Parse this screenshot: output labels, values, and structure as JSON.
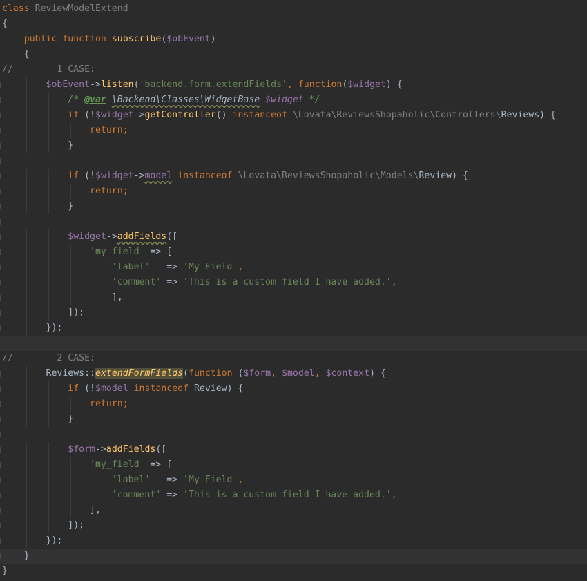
{
  "editor": {
    "lines": [
      [
        [
          "class",
          "kw"
        ],
        [
          " ReviewModelExtend",
          "cmt"
        ]
      ],
      [
        [
          "{",
          "p"
        ]
      ],
      [
        [
          "    ",
          "p"
        ],
        [
          "public",
          "kw"
        ],
        [
          " ",
          "p"
        ],
        [
          "function",
          "kw"
        ],
        [
          " ",
          "p"
        ],
        [
          "subscribe",
          "fn"
        ],
        [
          "(",
          "p"
        ],
        [
          "$obEvent",
          "var"
        ],
        [
          ")",
          "p"
        ]
      ],
      [
        [
          "    {",
          "p"
        ]
      ],
      [
        [
          "//        1 CASE:",
          "cmt"
        ]
      ],
      [
        [
          "        ",
          "p"
        ],
        [
          "$obEvent",
          "var"
        ],
        [
          "->",
          "p"
        ],
        [
          "listen",
          "fn"
        ],
        [
          "(",
          "p"
        ],
        [
          "'backend.form.extendFields'",
          "str"
        ],
        [
          ", ",
          "kw"
        ],
        [
          "function",
          "kw"
        ],
        [
          "(",
          "p"
        ],
        [
          "$widget",
          "var"
        ],
        [
          ") {",
          "p"
        ]
      ],
      [
        [
          "            ",
          "p"
        ],
        [
          "/* ",
          "doc"
        ],
        [
          "@var",
          "doctag"
        ],
        [
          " ",
          "doc"
        ],
        [
          "\\Backend\\Classes\\WidgetBase",
          "ital warn"
        ],
        [
          " ",
          "doc"
        ],
        [
          "$widget",
          "docvar"
        ],
        [
          " */",
          "doc"
        ]
      ],
      [
        [
          "            ",
          "p"
        ],
        [
          "if",
          "kw"
        ],
        [
          " (!",
          "p"
        ],
        [
          "$widget",
          "var"
        ],
        [
          "->",
          "p"
        ],
        [
          "getController",
          "fn"
        ],
        [
          "() ",
          "p"
        ],
        [
          "instanceof",
          "kw"
        ],
        [
          " \\Lovata\\ReviewsShopaholic\\Controllers\\",
          "ns"
        ],
        [
          "Reviews",
          "p"
        ],
        [
          ") {",
          "p"
        ]
      ],
      [
        [
          "                ",
          "p"
        ],
        [
          "return",
          "kw"
        ],
        [
          ";",
          "kw"
        ]
      ],
      [
        [
          "            }",
          "p"
        ]
      ],
      [
        [
          "",
          "p"
        ]
      ],
      [
        [
          "            ",
          "p"
        ],
        [
          "if",
          "kw"
        ],
        [
          " (!",
          "p"
        ],
        [
          "$widget",
          "var"
        ],
        [
          "->",
          "p"
        ],
        [
          "model",
          "var warn"
        ],
        [
          " ",
          "p"
        ],
        [
          "instanceof",
          "kw"
        ],
        [
          " \\Lovata\\ReviewsShopaholic\\Models\\",
          "ns"
        ],
        [
          "Review",
          "p"
        ],
        [
          ") {",
          "p"
        ]
      ],
      [
        [
          "                ",
          "p"
        ],
        [
          "return",
          "kw"
        ],
        [
          ";",
          "kw"
        ]
      ],
      [
        [
          "            }",
          "p"
        ]
      ],
      [
        [
          "",
          "p"
        ]
      ],
      [
        [
          "            ",
          "p"
        ],
        [
          "$widget",
          "var"
        ],
        [
          "->",
          "p"
        ],
        [
          "addFields",
          "fn warn"
        ],
        [
          "([",
          "p"
        ]
      ],
      [
        [
          "                ",
          "p"
        ],
        [
          "'my_field'",
          "str"
        ],
        [
          " => [",
          "p"
        ]
      ],
      [
        [
          "                    ",
          "p"
        ],
        [
          "'label'",
          "str"
        ],
        [
          "   => ",
          "p"
        ],
        [
          "'My Field'",
          "str"
        ],
        [
          ",",
          "kw"
        ]
      ],
      [
        [
          "                    ",
          "p"
        ],
        [
          "'comment'",
          "str"
        ],
        [
          " => ",
          "p"
        ],
        [
          "'This is a custom field I have added.'",
          "str"
        ],
        [
          ",",
          "kw"
        ]
      ],
      [
        [
          "                    ",
          "p"
        ],
        [
          "],",
          "p"
        ]
      ],
      [
        [
          "            ",
          "p"
        ],
        [
          "]);",
          "p"
        ]
      ],
      [
        [
          "        ",
          "p"
        ],
        [
          "});",
          "p"
        ]
      ],
      [
        [
          "",
          "p"
        ]
      ],
      [
        [
          "//        2 CASE:",
          "cmt"
        ]
      ],
      [
        [
          "        ",
          "p"
        ],
        [
          "Reviews::",
          "p"
        ],
        [
          "extendFormFields",
          "fn ital hl"
        ],
        [
          "(",
          "p"
        ],
        [
          "function",
          "kw"
        ],
        [
          " (",
          "p"
        ],
        [
          "$form",
          "var"
        ],
        [
          ", ",
          "kw"
        ],
        [
          "$model",
          "var"
        ],
        [
          ", ",
          "kw"
        ],
        [
          "$context",
          "var"
        ],
        [
          ") {",
          "p"
        ]
      ],
      [
        [
          "            ",
          "p"
        ],
        [
          "if",
          "kw"
        ],
        [
          " (!",
          "p"
        ],
        [
          "$model",
          "var"
        ],
        [
          " ",
          "p"
        ],
        [
          "instanceof",
          "kw"
        ],
        [
          " Review) {",
          "p"
        ]
      ],
      [
        [
          "                ",
          "p"
        ],
        [
          "return",
          "kw"
        ],
        [
          ";",
          "kw"
        ]
      ],
      [
        [
          "            }",
          "p"
        ]
      ],
      [
        [
          "",
          "p"
        ]
      ],
      [
        [
          "            ",
          "p"
        ],
        [
          "$form",
          "var"
        ],
        [
          "->",
          "p"
        ],
        [
          "addFields",
          "fn"
        ],
        [
          "([",
          "p"
        ]
      ],
      [
        [
          "                ",
          "p"
        ],
        [
          "'my_field'",
          "str"
        ],
        [
          " => [",
          "p"
        ]
      ],
      [
        [
          "                    ",
          "p"
        ],
        [
          "'label'",
          "str"
        ],
        [
          "   => ",
          "p"
        ],
        [
          "'My Field'",
          "str"
        ],
        [
          ",",
          "kw"
        ]
      ],
      [
        [
          "                    ",
          "p"
        ],
        [
          "'comment'",
          "str"
        ],
        [
          " => ",
          "p"
        ],
        [
          "'This is a custom field I have added.'",
          "str"
        ],
        [
          ",",
          "kw"
        ]
      ],
      [
        [
          "                ",
          "p"
        ],
        [
          "],",
          "p"
        ]
      ],
      [
        [
          "            ",
          "p"
        ],
        [
          "]);",
          "p"
        ]
      ],
      [
        [
          "        ",
          "p"
        ],
        [
          "});",
          "p"
        ]
      ],
      [
        [
          "    }",
          "p"
        ]
      ],
      [
        [
          "}",
          "p"
        ]
      ]
    ]
  }
}
